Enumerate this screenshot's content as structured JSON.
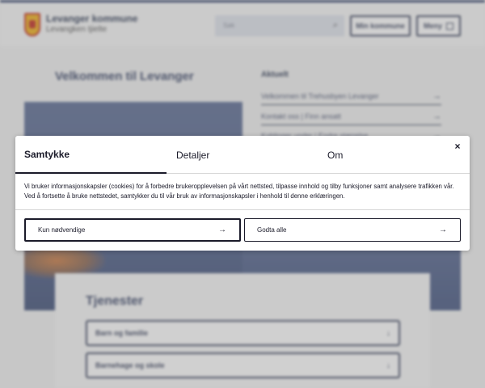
{
  "header": {
    "site_name": "Levanger kommune",
    "site_sub": "Levangken tjielte",
    "search_placeholder": "Søk",
    "min_kommune": "Min kommune",
    "meny": "Meny"
  },
  "main": {
    "welcome": "Velkommen til Levanger",
    "aktuelt_title": "Aktuelt",
    "news": [
      "Velkommen til Trehusbyen Levanger",
      "Kontakt oss | Finn ansatt",
      "Koblinger under | Endre størrelse"
    ],
    "services_title": "Tjenester",
    "services": [
      "Barn og familie",
      "Barnehage og skole"
    ]
  },
  "consent": {
    "tabs": [
      "Samtykke",
      "Detaljer",
      "Om"
    ],
    "active_tab": "Samtykke",
    "text": "Vi bruker informasjonskapsler (cookies) for å forbedre brukeropplevelsen på vårt nettsted, tilpasse innhold og tilby funksjoner samt analysere trafikken vår. Ved å fortsette å bruke nettstedet, samtykker du til vår bruk av informasjonskapsler i henhold til denne erklæringen.",
    "button_necessary": "Kun nødvendige",
    "button_accept": "Godta alle",
    "close": "×",
    "arrow": "→"
  },
  "colors": {
    "brand": "#2a3b66",
    "text": "#1b1b2a",
    "logo_gold": "#f0b21b",
    "logo_red": "#c22a1f"
  }
}
